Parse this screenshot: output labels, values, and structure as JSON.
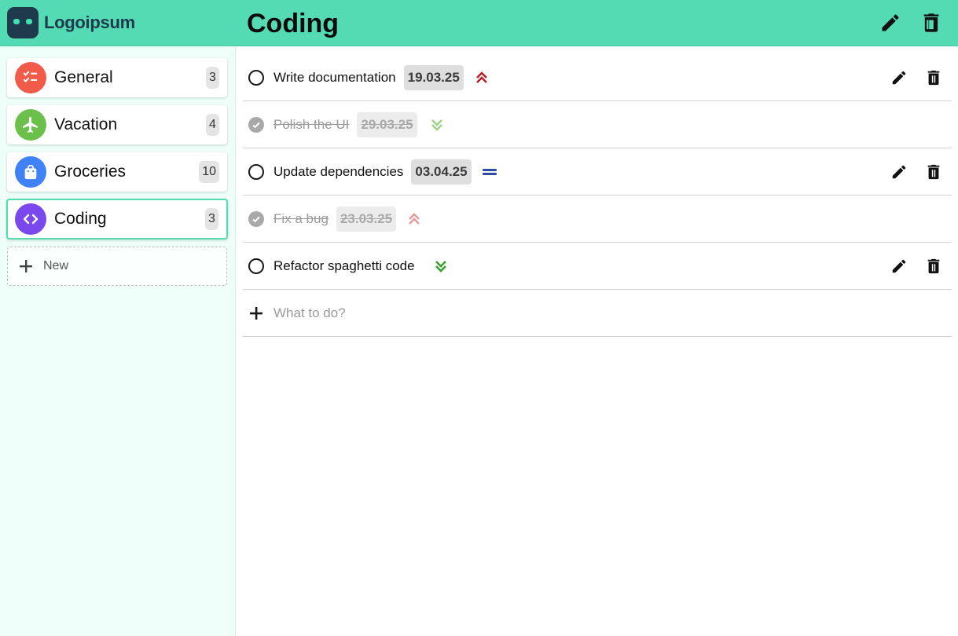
{
  "app": {
    "logo_text": "Logoipsum",
    "accent": "#54dbb3"
  },
  "header": {
    "title": "Coding",
    "actions": [
      {
        "name": "edit-list-button",
        "icon": "pencil-icon"
      },
      {
        "name": "delete-list-button",
        "icon": "trash-icon"
      }
    ]
  },
  "sidebar": {
    "categories": [
      {
        "label": "General",
        "count": "3",
        "icon": "checklist-icon",
        "color": "#f15b4a",
        "active": false
      },
      {
        "label": "Vacation",
        "count": "4",
        "icon": "airplane-icon",
        "color": "#6bbf4b",
        "active": false
      },
      {
        "label": "Groceries",
        "count": "10",
        "icon": "shopping-bag-icon",
        "color": "#3e82f5",
        "active": false
      },
      {
        "label": "Coding",
        "count": "3",
        "icon": "code-icon",
        "color": "#7b48ee",
        "active": true
      }
    ],
    "new_label": "New"
  },
  "tasks": [
    {
      "text": "Write documentation",
      "date": "19.03.25",
      "priority": "highest",
      "done": false
    },
    {
      "text": "Polish the UI",
      "date": "29.03.25",
      "priority": "lowest",
      "done": true
    },
    {
      "text": "Update dependencies",
      "date": "03.04.25",
      "priority": "medium",
      "done": false
    },
    {
      "text": "Fix a bug",
      "date": "23.03.25",
      "priority": "highest",
      "done": true
    },
    {
      "text": "Refactor spaghetti code",
      "date": "",
      "priority": "lowest",
      "done": false
    }
  ],
  "add_task": {
    "placeholder": "What to do?"
  }
}
